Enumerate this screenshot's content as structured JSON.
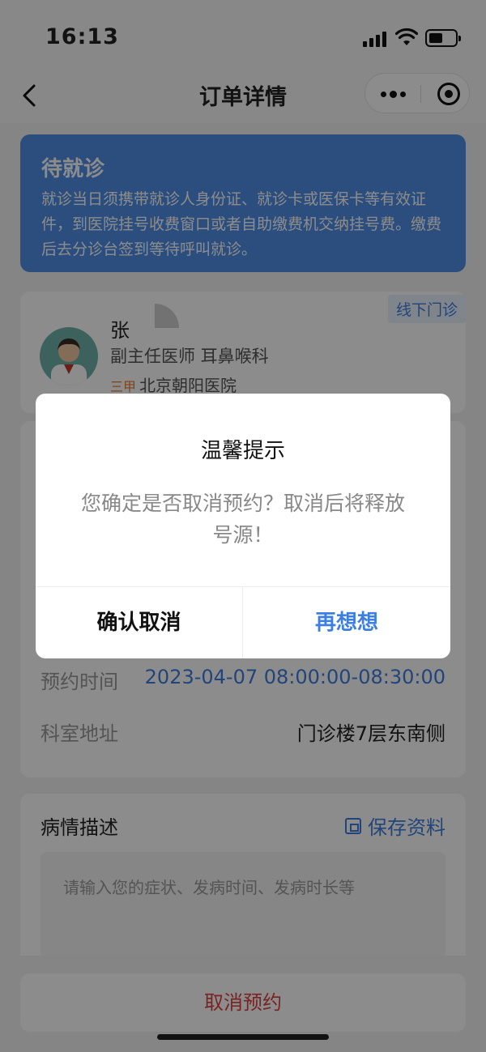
{
  "status_bar": {
    "time": "16:13"
  },
  "nav": {
    "title": "订单详情"
  },
  "banner": {
    "title": "待就诊",
    "text": "就诊当日须携带就诊人身份证、就诊卡或医保卡等有效证件，到医院挂号收费窗口或者自助缴费机交纳挂号费。缴费后去分诊台签到等待呼叫就诊。"
  },
  "doctor": {
    "tag": "线下门诊",
    "name": "张",
    "title": "副主任医师 耳鼻喉科",
    "hospital_grade": "三甲",
    "hospital": "北京朝阳医院"
  },
  "appointment": {
    "time_label": "预约时间",
    "time_value": "2023-04-07 08:00:00-08:30:00",
    "address_label": "科室地址",
    "address_value": "门诊楼7层东南侧"
  },
  "description": {
    "title": "病情描述",
    "save_label": "保存资料",
    "placeholder": "请输入您的症状、发病时间、发病时长等"
  },
  "bottom": {
    "cancel_label": "取消预约"
  },
  "modal": {
    "title": "温馨提示",
    "message": "您确定是否取消预约？取消后将释放号源！",
    "confirm_label": "确认取消",
    "reconsider_label": "再想想"
  },
  "colors": {
    "accent": "#3c7fe0",
    "banner": "#4f8fe6",
    "danger": "#e03e3e",
    "grade": "#e87a2c"
  }
}
